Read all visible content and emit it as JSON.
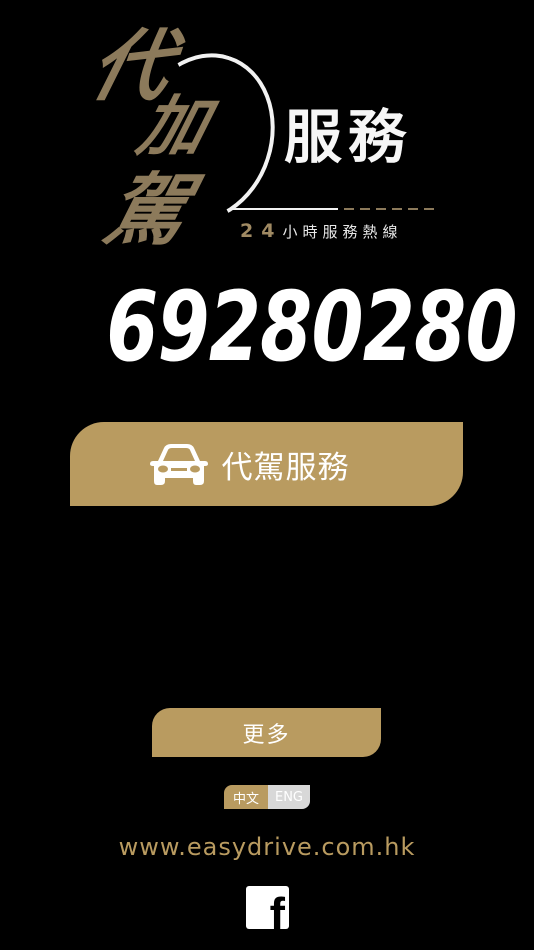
{
  "logo": {
    "chars": [
      "代",
      "加",
      "駕"
    ],
    "heading": "服務",
    "hotline_number": "24",
    "hotline_label": "小時服務熱線"
  },
  "phone_number": "69280280",
  "primary_button": {
    "label": "代駕服務",
    "icon": "car-icon"
  },
  "more_button": {
    "label": "更多"
  },
  "language": {
    "zh": "中文",
    "en": "ENG",
    "selected": "zh"
  },
  "website": "www.easydrive.com.hk",
  "social": {
    "icon": "facebook-icon",
    "glyph": "f"
  },
  "colors": {
    "background": "#000000",
    "accent": "#b99b60",
    "logo_gold": "#8c7a5b",
    "text": "#ffffff"
  }
}
